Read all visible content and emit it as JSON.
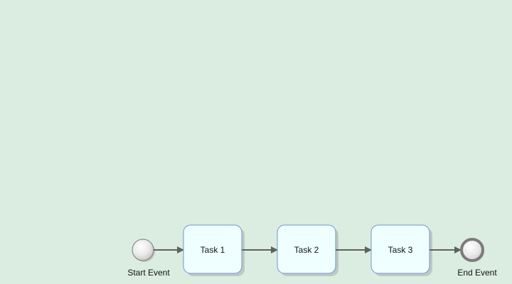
{
  "diagram": {
    "background_color": "#dbede1",
    "start_event": {
      "label": "Start Event",
      "icon": "start-event-circle"
    },
    "tasks": [
      {
        "label": "Task 1"
      },
      {
        "label": "Task 2"
      },
      {
        "label": "Task 3"
      }
    ],
    "end_event": {
      "label": "End Event",
      "icon": "end-event-circle"
    },
    "colors": {
      "task_fill": "#efffff",
      "task_stroke": "#6f97c9",
      "connector": "#5f615f",
      "event_stroke": "#7b7b7b",
      "shadow": "#bfc8c2"
    }
  }
}
